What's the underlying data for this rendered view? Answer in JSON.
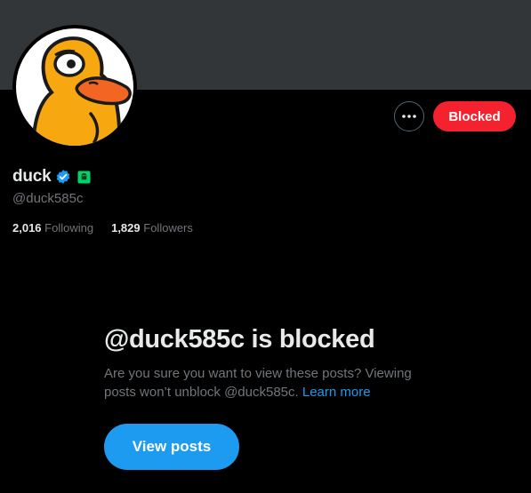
{
  "profile": {
    "avatar_icon": "duck-avatar-icon",
    "display_name": "duck",
    "handle": "@duck585c",
    "verified_icon": "verified-badge-icon",
    "affiliation_icon": "affiliate-badge-icon",
    "following_count": "2,016",
    "following_label": "Following",
    "followers_count": "1,829",
    "followers_label": "Followers"
  },
  "actions": {
    "more_icon": "more-horizontal-icon",
    "blocked_label": "Blocked"
  },
  "blocked_notice": {
    "title": "@duck585c is blocked",
    "description": "Are you sure you want to view these posts? Viewing posts won’t unblock @duck585c.",
    "learn_more": "Learn more",
    "view_posts_label": "View posts"
  },
  "colors": {
    "banner": "#333639",
    "background": "#000000",
    "blocked_red": "#f4212e",
    "accent_blue": "#1d9bf0",
    "muted_text": "#71767b",
    "affiliate_green": "#00d26a"
  }
}
